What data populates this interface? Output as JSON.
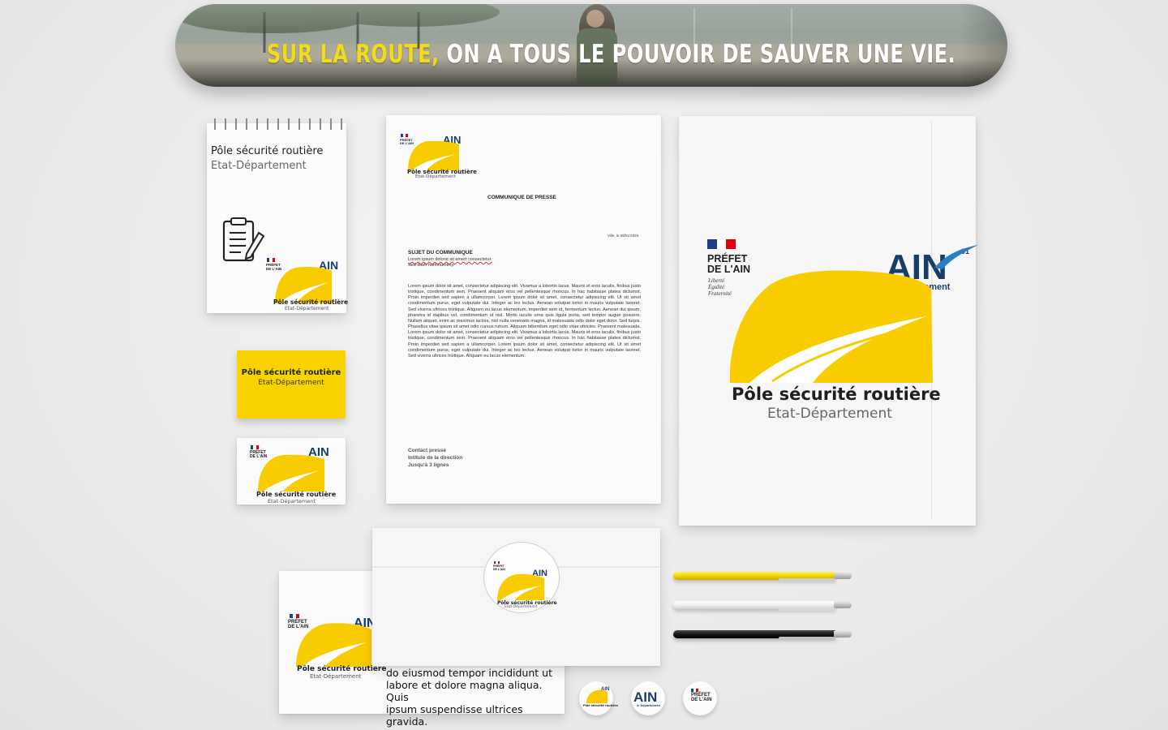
{
  "colors": {
    "brand_yellow": "#f9cc00",
    "ain_blue": "#173e68",
    "flag_blue": "#1f3d8a",
    "flag_red": "#e1000f"
  },
  "poster": {
    "tagline_highlight": "SUR LA ROUTE,",
    "tagline_rest": "ON A TOUS LE POUVOIR DE SAUVER UNE VIE."
  },
  "brand": {
    "name": "Pôle sécurité routière",
    "subtitle": "Etat-Département",
    "prefet_line1": "PRÉFET",
    "prefet_line2": "DE L'AIN",
    "devise": [
      "Liberté",
      "Égalité",
      "Fraternité"
    ],
    "ain": "AIN",
    "ain_number": "01",
    "ain_sub": "le Département"
  },
  "notepad": {
    "title": "Pôle sécurité routière",
    "subtitle": "Etat-Département",
    "icon": "clipboard-pen-icon"
  },
  "card_yellow": {
    "title": "Pôle sécurité routière",
    "subtitle": "Etat-Département"
  },
  "letter": {
    "heading": "COMMUNIQUE DE PRESSE",
    "date": "Ville, le 08/01/2020",
    "subject_label": "SUJET DU COMMUNIQUE",
    "subject_line1": "Lorem ipsum dolorst sit amert consectetur.",
    "subject_line2": "Sed diam nummumimy.",
    "body": "Lorem ipsum dolor sit amet, consectetur adipiscing elit. Vivamus a lobortis lacus. Mauris et eros iaculis, finibus justo tristique, condimentum sem. Praesent aliquam eros vel pellentesque rhoncus. In hac habitasse platea dictumst. Proin imperdiet sed sapien a ullamcorper. Lorem ipsum dolor sit amet, consectetur adipiscing elit. Ut sit amet condimentum purus, eget vulputate dui. Integer ac leo lectus. Aenean volutpat tortor in mauris vulputate laoreet. Sed viverra ultrices tristique. Aliquam eu lacus elementum, imperdiet sem id, fermentum lectus. Aenean dui ipsum, pharetra id dapibus vel, condimentum ut nisl. Morbi iaculis urna quis ligula porta, sed tempor augue posuere. Nullam aliquet, enim ac maximus lacinia, nisl nulla venenatis magna, id malesuada odio dolor eget dolor. Sed turpis. Phasellus vitae ipsum sit amet odio cursus rutrum. Aliquam bibendum eget odio vitae ultricies. Praesent malesuada. Lorem ipsum dolor sit amet, consectetur adipiscing elit. Vivamus a lobortis lacus. Mauris et eros iaculis, finibus justo tristique, condimentum sem. Praesent aliquam eros vel pellentesque rhoncus. In hac habitasse platea dictumst. Proin imperdiet sed sapien a ullamcorper. Lorem ipsum dolor sit amet, consectetur adipiscing elit. Ut sit amet condimentum purus, eget vulputate dui. Integer ac leo lectus. Aenean volutpat tortor in mauris vulputate laoreet. Sed viverra ultrices tristique. Aliquam eu lacus elementum.",
    "contact_line1": "Contact presse",
    "contact_line2": "Intitulé de la direction",
    "contact_line3": "Jusqu'à 3 lignes"
  },
  "folder": {
    "title": "Pôle sécurité routière",
    "subtitle": "Etat-Département"
  },
  "envelope_card": {
    "text_line1": "do eiusmod tempor incididunt ut",
    "text_line2": "labore et dolore magna aliqua. Quis",
    "text_line3": "ipsum suspendisse ultrices gravida."
  },
  "pens": [
    {
      "color": "#f4d800"
    },
    {
      "color": "#ffffff"
    },
    {
      "color": "#1a1a1a"
    }
  ]
}
